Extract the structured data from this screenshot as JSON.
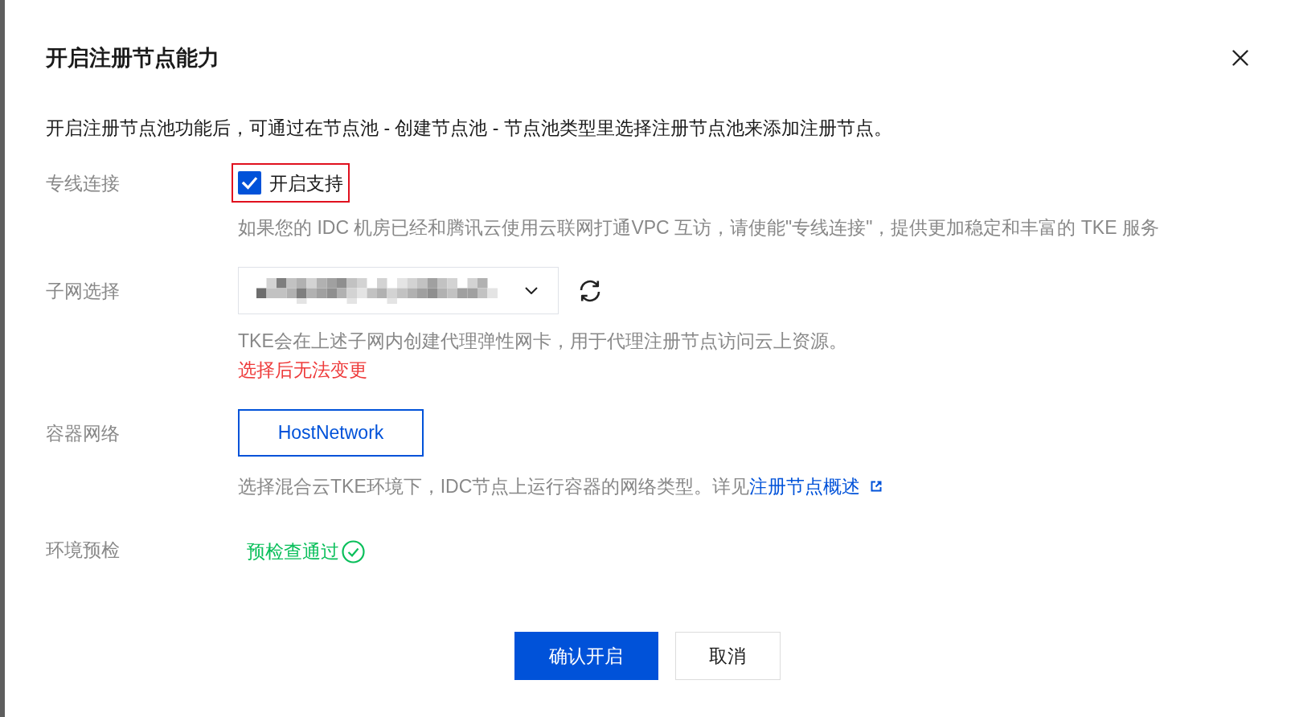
{
  "dialog": {
    "title": "开启注册节点能力",
    "description": "开启注册节点池功能后，可通过在节点池 - 创建节点池 - 节点池类型里选择注册节点池来添加注册节点。"
  },
  "fields": [
    {
      "kind": "checkbox",
      "label": "专线连接",
      "option": "开启支持",
      "checked": true,
      "highlighted": true,
      "help": "如果您的 IDC 机房已经和腾讯云使用云联网打通VPC 互访，请使能\"专线连接\"，提供更加稳定和丰富的 TKE 服务"
    },
    {
      "kind": "select",
      "label": "子网选择",
      "help": "TKE会在上述子网内创建代理弹性网卡，用于代理注册节点访问云上资源。",
      "warning": "选择后无法变更"
    },
    {
      "kind": "options",
      "label": "容器网络",
      "options": [
        {
          "label": "HostNetwork",
          "selected": true
        }
      ],
      "help": "选择混合云TKE环境下，IDC节点上运行容器的网络类型。详见",
      "link": "注册节点概述"
    },
    {
      "kind": "status",
      "label": "环境预检",
      "status": "预检查通过",
      "passed": true
    }
  ],
  "buttons": [
    {
      "label": "确认开启",
      "kind": "primary"
    },
    {
      "label": "取消",
      "kind": "default"
    }
  ]
}
